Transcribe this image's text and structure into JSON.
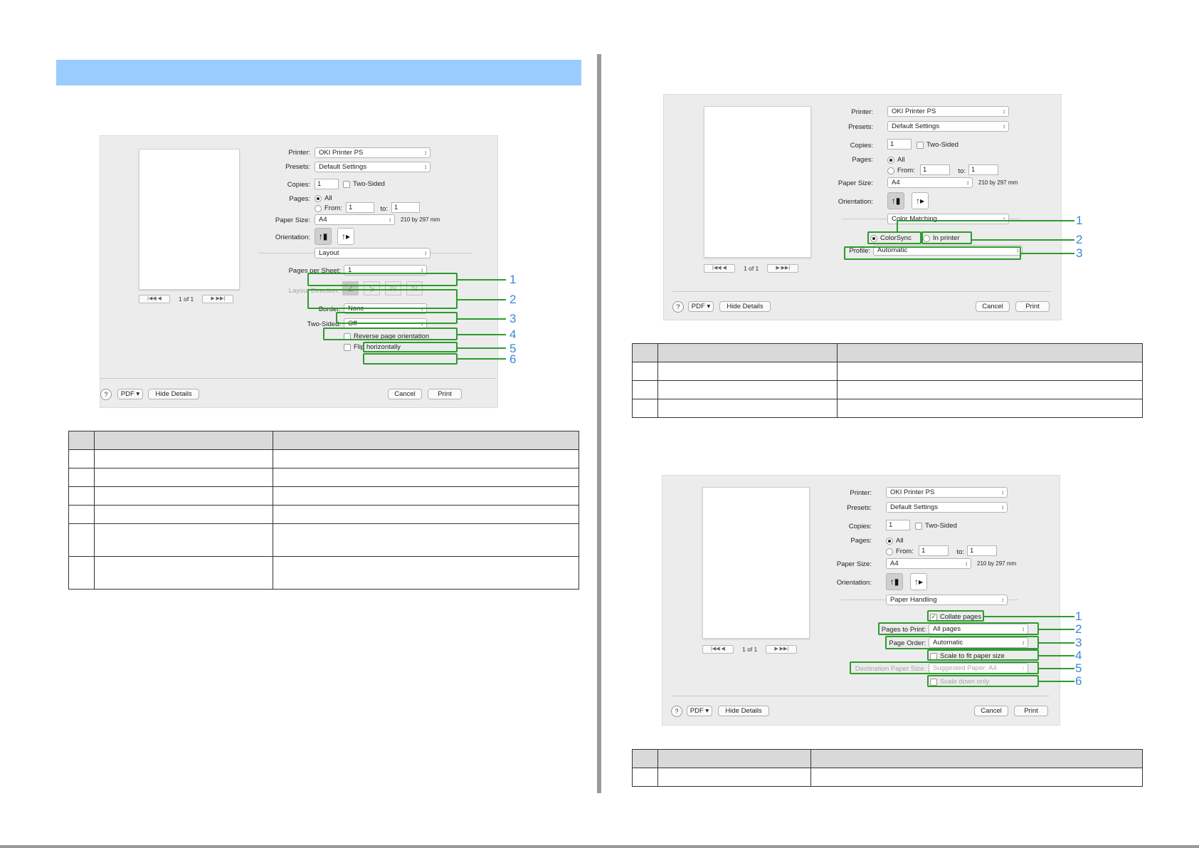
{
  "dialogs": {
    "layout": {
      "printer_label": "Printer:",
      "printer": "OKI Printer PS",
      "presets_label": "Presets:",
      "presets": "Default Settings",
      "copies_label": "Copies:",
      "copies": "1",
      "two_sided_check": "Two-Sided",
      "pages_label": "Pages:",
      "all": "All",
      "from": "From:",
      "from_value": "1",
      "to": "to:",
      "to_value": "1",
      "paper_size_label": "Paper Size:",
      "paper_size": "A4",
      "paper_dims": "210 by 297 mm",
      "orientation_label": "Orientation:",
      "panel": "Layout",
      "pages_per_sheet_label": "Pages per Sheet:",
      "pages_per_sheet": "1",
      "layout_direction_label": "Layout Direction:",
      "border_label": "Border:",
      "border": "None",
      "two_sided_label": "Two-Sided:",
      "two_sided": "Off",
      "reverse": "Reverse page orientation",
      "flip": "Flip horizontally",
      "page_count": "1 of 1",
      "pdf": "PDF ▾",
      "hide_details": "Hide Details",
      "cancel": "Cancel",
      "print": "Print"
    },
    "color": {
      "printer_label": "Printer:",
      "printer": "OKI Printer PS",
      "presets_label": "Presets:",
      "presets": "Default Settings",
      "copies_label": "Copies:",
      "copies": "1",
      "two_sided_check": "Two-Sided",
      "pages_label": "Pages:",
      "all": "All",
      "from": "From:",
      "from_value": "1",
      "to": "to:",
      "to_value": "1",
      "paper_size_label": "Paper Size:",
      "paper_size": "A4",
      "paper_dims": "210 by 297 mm",
      "orientation_label": "Orientation:",
      "panel": "Color Matching",
      "colorsync": "ColorSync",
      "in_printer": "In printer",
      "profile_label": "Profile:",
      "profile": "Automatic",
      "page_count": "1 of 1",
      "pdf": "PDF ▾",
      "hide_details": "Hide Details",
      "cancel": "Cancel",
      "print": "Print"
    },
    "paper": {
      "printer_label": "Printer:",
      "printer": "OKI Printer PS",
      "presets_label": "Presets:",
      "presets": "Default Settings",
      "copies_label": "Copies:",
      "copies": "1",
      "two_sided_check": "Two-Sided",
      "pages_label": "Pages:",
      "all": "All",
      "from": "From:",
      "from_value": "1",
      "to": "to:",
      "to_value": "1",
      "paper_size_label": "Paper Size:",
      "paper_size": "A4",
      "paper_dims": "210 by 297 mm",
      "orientation_label": "Orientation:",
      "panel": "Paper Handling",
      "collate": "Collate pages",
      "pages_to_print_label": "Pages to Print:",
      "pages_to_print": "All pages",
      "page_order_label": "Page Order:",
      "page_order": "Automatic",
      "scale_fit": "Scale to fit paper size",
      "dest_label": "Destination Paper Size:",
      "dest": "Suggested Paper: A4",
      "scale_down": "Scale down only",
      "page_count": "1 of 1",
      "pdf": "PDF ▾",
      "hide_details": "Hide Details",
      "cancel": "Cancel",
      "print": "Print"
    }
  },
  "callouts": {
    "layout": [
      "1",
      "2",
      "3",
      "4",
      "5",
      "6"
    ],
    "color": [
      "1",
      "2",
      "3"
    ],
    "paper": [
      "1",
      "2",
      "3",
      "4",
      "5",
      "6"
    ]
  },
  "icons": {
    "help": "?",
    "portrait": "↑▮",
    "landscape": "↑▸",
    "nav_first": "|◀◀  ◀",
    "nav_next": "▶  ▶▶|",
    "dir_z": "Z",
    "dir_s": "S",
    "dir_n": "N",
    "dir_n2": "N"
  },
  "colors": {
    "header": "#99ccff",
    "highlight": "#2d9b2d",
    "callout": "#3a87d8"
  }
}
